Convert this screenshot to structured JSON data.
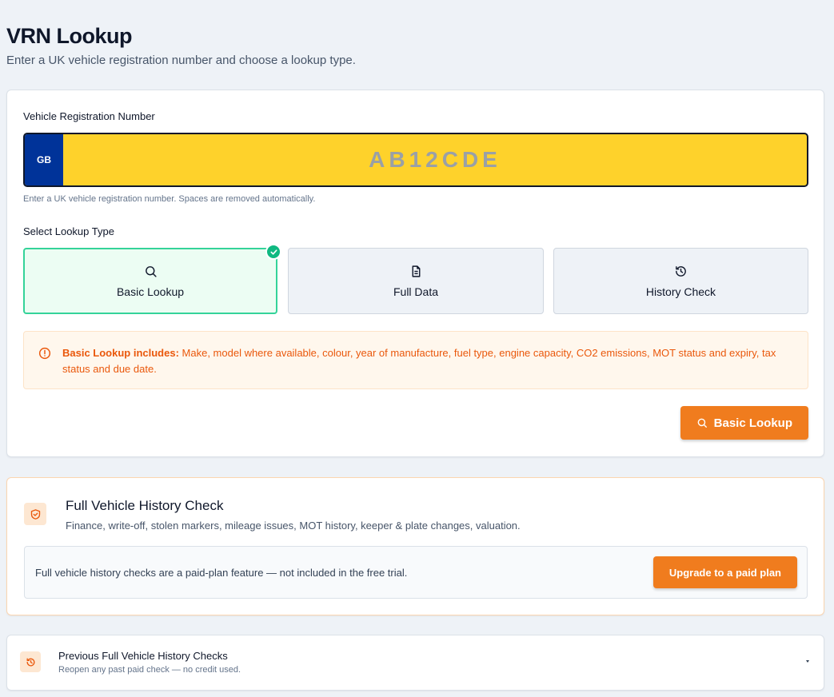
{
  "page": {
    "title": "VRN Lookup",
    "subtitle": "Enter a UK vehicle registration number and choose a lookup type."
  },
  "lookup": {
    "vrn_label": "Vehicle Registration Number",
    "plate_badge": "GB",
    "plate_placeholder": "AB12CDE",
    "plate_value": "",
    "helper_text": "Enter a UK vehicle registration number. Spaces are removed automatically.",
    "type_label": "Select Lookup Type",
    "types": [
      {
        "label": "Basic Lookup",
        "icon": "search-icon",
        "selected": true
      },
      {
        "label": "Full Data",
        "icon": "document-icon",
        "selected": false
      },
      {
        "label": "History Check",
        "icon": "history-icon",
        "selected": false
      }
    ],
    "info_bold": "Basic Lookup includes:",
    "info_text": " Make, model where available, colour, year of manufacture, fuel type, engine capacity, CO2 emissions, MOT status and expiry, tax status and due date.",
    "submit_label": "Basic Lookup"
  },
  "history": {
    "title": "Full Vehicle History Check",
    "description": "Finance, write-off, stolen markers, mileage issues, MOT history, keeper & plate changes, valuation.",
    "notice": "Full vehicle history checks are a paid-plan feature — not included in the free trial.",
    "upgrade_label": "Upgrade to a paid plan"
  },
  "previous": {
    "title": "Previous Full Vehicle History Checks",
    "description": "Reopen any past paid check — no credit used."
  },
  "colors": {
    "accent": "#f07c1e",
    "plate_yellow": "#fed22b",
    "plate_blue": "#003399",
    "selected_green": "#34d399",
    "info_orange": "#ea580c"
  }
}
